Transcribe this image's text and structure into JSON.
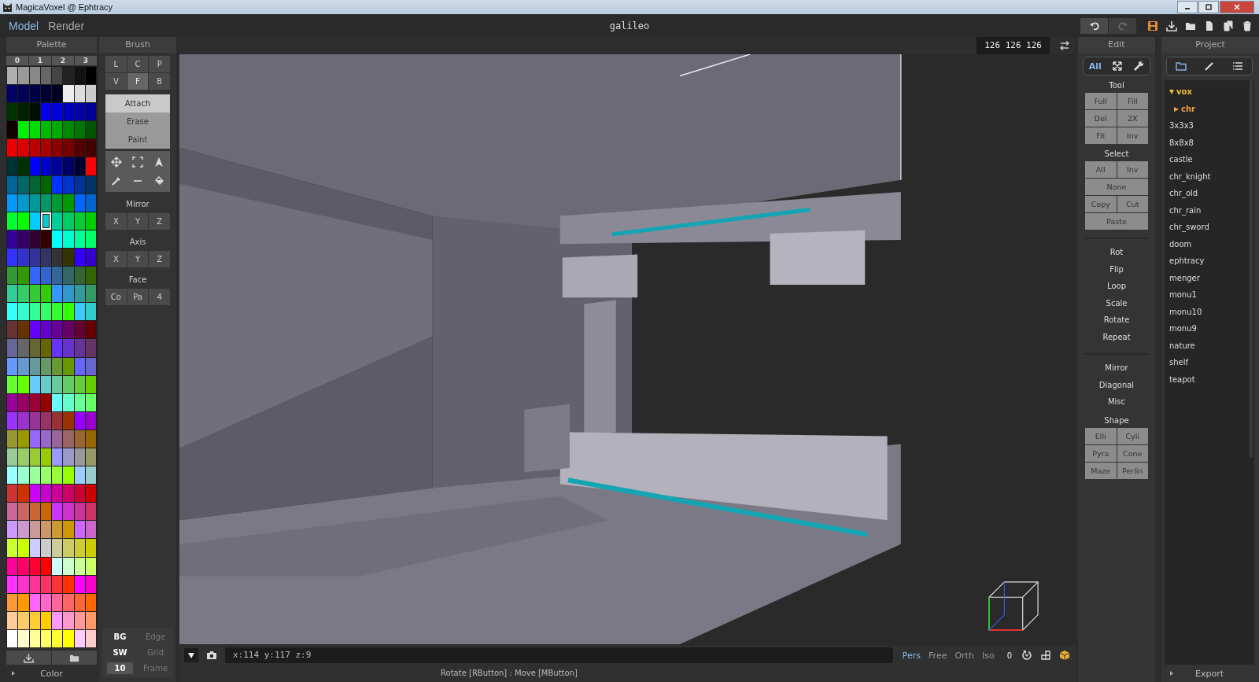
{
  "window": {
    "title": "MagicaVoxel @ Ephtracy"
  },
  "modes": [
    {
      "label": "Model",
      "selected": true
    },
    {
      "label": "Render",
      "selected": false
    }
  ],
  "document_title": "galileo",
  "palette": {
    "title": "Palette",
    "pages": [
      {
        "label": "0"
      },
      {
        "label": "1"
      },
      {
        "label": "2"
      },
      {
        "label": "3"
      }
    ],
    "swatches": [
      {
        "color": "#b0b0b0",
        "selected": false
      },
      {
        "color": "#999999",
        "selected": false
      },
      {
        "color": "#888888",
        "selected": false
      },
      {
        "color": "#666666",
        "selected": false
      },
      {
        "color": "#444444",
        "selected": false
      },
      {
        "color": "#222222",
        "selected": false
      },
      {
        "color": "#111111",
        "selected": false
      },
      {
        "color": "#000000",
        "selected": false
      },
      {
        "color": "#000066",
        "selected": false
      },
      {
        "color": "#000055",
        "selected": false
      },
      {
        "color": "#000044",
        "selected": false
      },
      {
        "color": "#000033",
        "selected": false
      },
      {
        "color": "#000022",
        "selected": false
      },
      {
        "color": "#eeeeee",
        "selected": false
      },
      {
        "color": "#dddddd",
        "selected": false
      },
      {
        "color": "#cccccc",
        "selected": false
      },
      {
        "color": "#003300",
        "selected": false
      },
      {
        "color": "#002200",
        "selected": false
      },
      {
        "color": "#001100",
        "selected": false
      },
      {
        "color": "#0000ee",
        "selected": false
      },
      {
        "color": "#0000dd",
        "selected": false
      },
      {
        "color": "#0000bb",
        "selected": false
      },
      {
        "color": "#0000aa",
        "selected": false
      },
      {
        "color": "#000099",
        "selected": false
      },
      {
        "color": "#110000",
        "selected": false
      },
      {
        "color": "#00ee00",
        "selected": false
      },
      {
        "color": "#00dd00",
        "selected": false
      },
      {
        "color": "#00bb00",
        "selected": false
      },
      {
        "color": "#00aa00",
        "selected": false
      },
      {
        "color": "#008800",
        "selected": false
      },
      {
        "color": "#007700",
        "selected": false
      },
      {
        "color": "#005500",
        "selected": false
      },
      {
        "color": "#ee0000",
        "selected": false
      },
      {
        "color": "#dd0000",
        "selected": false
      },
      {
        "color": "#bb0000",
        "selected": false
      },
      {
        "color": "#aa0000",
        "selected": false
      },
      {
        "color": "#880000",
        "selected": false
      },
      {
        "color": "#770000",
        "selected": false
      },
      {
        "color": "#550000",
        "selected": false
      },
      {
        "color": "#440000",
        "selected": false
      },
      {
        "color": "#003333",
        "selected": false
      },
      {
        "color": "#003300",
        "selected": false
      },
      {
        "color": "#0000ff",
        "selected": false
      },
      {
        "color": "#0000cc",
        "selected": false
      },
      {
        "color": "#000099",
        "selected": false
      },
      {
        "color": "#000066",
        "selected": false
      },
      {
        "color": "#000033",
        "selected": false
      },
      {
        "color": "#ff0000",
        "selected": false
      },
      {
        "color": "#006699",
        "selected": false
      },
      {
        "color": "#006666",
        "selected": false
      },
      {
        "color": "#006633",
        "selected": false
      },
      {
        "color": "#006600",
        "selected": false
      },
      {
        "color": "#0033ff",
        "selected": false
      },
      {
        "color": "#0033cc",
        "selected": false
      },
      {
        "color": "#003399",
        "selected": false
      },
      {
        "color": "#003366",
        "selected": false
      },
      {
        "color": "#0099ff",
        "selected": false
      },
      {
        "color": "#0099cc",
        "selected": false
      },
      {
        "color": "#009999",
        "selected": false
      },
      {
        "color": "#009966",
        "selected": false
      },
      {
        "color": "#009933",
        "selected": false
      },
      {
        "color": "#009900",
        "selected": false
      },
      {
        "color": "#0066ff",
        "selected": false
      },
      {
        "color": "#0066cc",
        "selected": false
      },
      {
        "color": "#00ff33",
        "selected": false
      },
      {
        "color": "#00ff00",
        "selected": false
      },
      {
        "color": "#00ccff",
        "selected": false
      },
      {
        "color": "#00cccc",
        "selected": true
      },
      {
        "color": "#00cc99",
        "selected": false
      },
      {
        "color": "#00cc66",
        "selected": false
      },
      {
        "color": "#00cc33",
        "selected": false
      },
      {
        "color": "#00cc00",
        "selected": false
      },
      {
        "color": "#330099",
        "selected": false
      },
      {
        "color": "#330066",
        "selected": false
      },
      {
        "color": "#330033",
        "selected": false
      },
      {
        "color": "#330000",
        "selected": false
      },
      {
        "color": "#00ffff",
        "selected": false
      },
      {
        "color": "#00ffcc",
        "selected": false
      },
      {
        "color": "#00ff99",
        "selected": false
      },
      {
        "color": "#00ff66",
        "selected": false
      },
      {
        "color": "#3333ff",
        "selected": false
      },
      {
        "color": "#3333cc",
        "selected": false
      },
      {
        "color": "#333399",
        "selected": false
      },
      {
        "color": "#333366",
        "selected": false
      },
      {
        "color": "#333333",
        "selected": false
      },
      {
        "color": "#333300",
        "selected": false
      },
      {
        "color": "#3300ff",
        "selected": false
      },
      {
        "color": "#3300cc",
        "selected": false
      },
      {
        "color": "#339933",
        "selected": false
      },
      {
        "color": "#339900",
        "selected": false
      },
      {
        "color": "#3366ff",
        "selected": false
      },
      {
        "color": "#3366cc",
        "selected": false
      },
      {
        "color": "#336699",
        "selected": false
      },
      {
        "color": "#336666",
        "selected": false
      },
      {
        "color": "#336633",
        "selected": false
      },
      {
        "color": "#336600",
        "selected": false
      },
      {
        "color": "#33cc99",
        "selected": false
      },
      {
        "color": "#33cc66",
        "selected": false
      },
      {
        "color": "#33cc33",
        "selected": false
      },
      {
        "color": "#33cc00",
        "selected": false
      },
      {
        "color": "#3399ff",
        "selected": false
      },
      {
        "color": "#3399cc",
        "selected": false
      },
      {
        "color": "#339999",
        "selected": false
      },
      {
        "color": "#339966",
        "selected": false
      },
      {
        "color": "#33ffff",
        "selected": false
      },
      {
        "color": "#33ffcc",
        "selected": false
      },
      {
        "color": "#33ff99",
        "selected": false
      },
      {
        "color": "#33ff66",
        "selected": false
      },
      {
        "color": "#33ff33",
        "selected": false
      },
      {
        "color": "#33ff00",
        "selected": false
      },
      {
        "color": "#33ccff",
        "selected": false
      },
      {
        "color": "#33cccc",
        "selected": false
      },
      {
        "color": "#663333",
        "selected": false
      },
      {
        "color": "#663300",
        "selected": false
      },
      {
        "color": "#6600ff",
        "selected": false
      },
      {
        "color": "#6600cc",
        "selected": false
      },
      {
        "color": "#660099",
        "selected": false
      },
      {
        "color": "#660066",
        "selected": false
      },
      {
        "color": "#660033",
        "selected": false
      },
      {
        "color": "#660000",
        "selected": false
      },
      {
        "color": "#666699",
        "selected": false
      },
      {
        "color": "#666666",
        "selected": false
      },
      {
        "color": "#666633",
        "selected": false
      },
      {
        "color": "#666600",
        "selected": false
      },
      {
        "color": "#6633ff",
        "selected": false
      },
      {
        "color": "#6633cc",
        "selected": false
      },
      {
        "color": "#663399",
        "selected": false
      },
      {
        "color": "#663366",
        "selected": false
      },
      {
        "color": "#6699ff",
        "selected": false
      },
      {
        "color": "#6699cc",
        "selected": false
      },
      {
        "color": "#669999",
        "selected": false
      },
      {
        "color": "#669966",
        "selected": false
      },
      {
        "color": "#669933",
        "selected": false
      },
      {
        "color": "#669900",
        "selected": false
      },
      {
        "color": "#6666ff",
        "selected": false
      },
      {
        "color": "#6666cc",
        "selected": false
      },
      {
        "color": "#66ff33",
        "selected": false
      },
      {
        "color": "#66ff00",
        "selected": false
      },
      {
        "color": "#66ccff",
        "selected": false
      },
      {
        "color": "#66cccc",
        "selected": false
      },
      {
        "color": "#66cc99",
        "selected": false
      },
      {
        "color": "#66cc66",
        "selected": false
      },
      {
        "color": "#66cc33",
        "selected": false
      },
      {
        "color": "#66cc00",
        "selected": false
      },
      {
        "color": "#990099",
        "selected": false
      },
      {
        "color": "#990066",
        "selected": false
      },
      {
        "color": "#990033",
        "selected": false
      },
      {
        "color": "#990000",
        "selected": false
      },
      {
        "color": "#66ffff",
        "selected": false
      },
      {
        "color": "#66ffcc",
        "selected": false
      },
      {
        "color": "#66ff99",
        "selected": false
      },
      {
        "color": "#66ff66",
        "selected": false
      },
      {
        "color": "#9933ff",
        "selected": false
      },
      {
        "color": "#9933cc",
        "selected": false
      },
      {
        "color": "#993399",
        "selected": false
      },
      {
        "color": "#993366",
        "selected": false
      },
      {
        "color": "#993333",
        "selected": false
      },
      {
        "color": "#993300",
        "selected": false
      },
      {
        "color": "#9900ff",
        "selected": false
      },
      {
        "color": "#9900cc",
        "selected": false
      },
      {
        "color": "#999933",
        "selected": false
      },
      {
        "color": "#999900",
        "selected": false
      },
      {
        "color": "#9966ff",
        "selected": false
      },
      {
        "color": "#9966cc",
        "selected": false
      },
      {
        "color": "#996699",
        "selected": false
      },
      {
        "color": "#996666",
        "selected": false
      },
      {
        "color": "#996633",
        "selected": false
      },
      {
        "color": "#996600",
        "selected": false
      },
      {
        "color": "#99cc99",
        "selected": false
      },
      {
        "color": "#99cc66",
        "selected": false
      },
      {
        "color": "#99cc33",
        "selected": false
      },
      {
        "color": "#99cc00",
        "selected": false
      },
      {
        "color": "#9999ff",
        "selected": false
      },
      {
        "color": "#9999cc",
        "selected": false
      },
      {
        "color": "#999999",
        "selected": false
      },
      {
        "color": "#999966",
        "selected": false
      },
      {
        "color": "#99ffff",
        "selected": false
      },
      {
        "color": "#99ffcc",
        "selected": false
      },
      {
        "color": "#99ff99",
        "selected": false
      },
      {
        "color": "#99ff66",
        "selected": false
      },
      {
        "color": "#99ff33",
        "selected": false
      },
      {
        "color": "#99ff00",
        "selected": false
      },
      {
        "color": "#99ccff",
        "selected": false
      },
      {
        "color": "#99cccc",
        "selected": false
      },
      {
        "color": "#cc3333",
        "selected": false
      },
      {
        "color": "#cc3300",
        "selected": false
      },
      {
        "color": "#cc00ff",
        "selected": false
      },
      {
        "color": "#cc00cc",
        "selected": false
      },
      {
        "color": "#cc0099",
        "selected": false
      },
      {
        "color": "#cc0066",
        "selected": false
      },
      {
        "color": "#cc0033",
        "selected": false
      },
      {
        "color": "#cc0000",
        "selected": false
      },
      {
        "color": "#cc6699",
        "selected": false
      },
      {
        "color": "#cc6666",
        "selected": false
      },
      {
        "color": "#cc6633",
        "selected": false
      },
      {
        "color": "#cc6600",
        "selected": false
      },
      {
        "color": "#cc33ff",
        "selected": false
      },
      {
        "color": "#cc33cc",
        "selected": false
      },
      {
        "color": "#cc3399",
        "selected": false
      },
      {
        "color": "#cc3366",
        "selected": false
      },
      {
        "color": "#cc99ff",
        "selected": false
      },
      {
        "color": "#cc99cc",
        "selected": false
      },
      {
        "color": "#cc9999",
        "selected": false
      },
      {
        "color": "#cc9966",
        "selected": false
      },
      {
        "color": "#cc9933",
        "selected": false
      },
      {
        "color": "#cc9900",
        "selected": false
      },
      {
        "color": "#cc66ff",
        "selected": false
      },
      {
        "color": "#cc66cc",
        "selected": false
      },
      {
        "color": "#ccff33",
        "selected": false
      },
      {
        "color": "#ccff00",
        "selected": false
      },
      {
        "color": "#ccccff",
        "selected": false
      },
      {
        "color": "#cccccc",
        "selected": false
      },
      {
        "color": "#cccc99",
        "selected": false
      },
      {
        "color": "#cccc66",
        "selected": false
      },
      {
        "color": "#cccc33",
        "selected": false
      },
      {
        "color": "#cccc00",
        "selected": false
      },
      {
        "color": "#ff0099",
        "selected": false
      },
      {
        "color": "#ff0066",
        "selected": false
      },
      {
        "color": "#ff0033",
        "selected": false
      },
      {
        "color": "#ff0000",
        "selected": false
      },
      {
        "color": "#ccffff",
        "selected": false
      },
      {
        "color": "#ccffcc",
        "selected": false
      },
      {
        "color": "#ccff99",
        "selected": false
      },
      {
        "color": "#ccff66",
        "selected": false
      },
      {
        "color": "#ff33ff",
        "selected": false
      },
      {
        "color": "#ff33cc",
        "selected": false
      },
      {
        "color": "#ff3399",
        "selected": false
      },
      {
        "color": "#ff3366",
        "selected": false
      },
      {
        "color": "#ff3333",
        "selected": false
      },
      {
        "color": "#ff3300",
        "selected": false
      },
      {
        "color": "#ff00ff",
        "selected": false
      },
      {
        "color": "#ff00cc",
        "selected": false
      },
      {
        "color": "#ff9933",
        "selected": false
      },
      {
        "color": "#ff9900",
        "selected": false
      },
      {
        "color": "#ff66ff",
        "selected": false
      },
      {
        "color": "#ff66cc",
        "selected": false
      },
      {
        "color": "#ff6699",
        "selected": false
      },
      {
        "color": "#ff6666",
        "selected": false
      },
      {
        "color": "#ff6633",
        "selected": false
      },
      {
        "color": "#ff6600",
        "selected": false
      },
      {
        "color": "#ffcc99",
        "selected": false
      },
      {
        "color": "#ffcc66",
        "selected": false
      },
      {
        "color": "#ffcc33",
        "selected": false
      },
      {
        "color": "#ffcc00",
        "selected": false
      },
      {
        "color": "#ff99ff",
        "selected": false
      },
      {
        "color": "#ff99cc",
        "selected": false
      },
      {
        "color": "#ff9999",
        "selected": false
      },
      {
        "color": "#ff9966",
        "selected": false
      },
      {
        "color": "#ffffff",
        "selected": false
      },
      {
        "color": "#ffffcc",
        "selected": false
      },
      {
        "color": "#ffff99",
        "selected": false
      },
      {
        "color": "#ffff66",
        "selected": false
      },
      {
        "color": "#ffff33",
        "selected": false
      },
      {
        "color": "#ffff00",
        "selected": false
      },
      {
        "color": "#ffccff",
        "selected": false
      },
      {
        "color": "#ffcccc",
        "selected": false
      }
    ],
    "footer_label": "Color"
  },
  "brush": {
    "title": "Brush",
    "shapes": [
      {
        "label": "L",
        "selected": false
      },
      {
        "label": "C",
        "selected": false
      },
      {
        "label": "P",
        "selected": false
      },
      {
        "label": "V",
        "selected": false
      },
      {
        "label": "F",
        "selected": true
      },
      {
        "label": "B",
        "selected": false
      }
    ],
    "actions": [
      {
        "label": "Attach",
        "selected": true
      },
      {
        "label": "Erase",
        "selected": false
      },
      {
        "label": "Paint",
        "selected": false
      }
    ],
    "groups": [
      {
        "title": "Mirror",
        "buttons": [
          "X",
          "Y",
          "Z"
        ]
      },
      {
        "title": "Axis",
        "buttons": [
          "X",
          "Y",
          "Z"
        ]
      },
      {
        "title": "Face",
        "buttons": [
          "Co",
          "Pa",
          "4"
        ]
      }
    ],
    "display": [
      {
        "kind": "toggle",
        "label": "BG",
        "on": true
      },
      {
        "kind": "toggle",
        "label": "Edge",
        "on": false
      },
      {
        "kind": "toggle",
        "label": "SW",
        "on": true
      },
      {
        "kind": "toggle",
        "label": "Grid",
        "on": false
      },
      {
        "kind": "field",
        "value": "10"
      },
      {
        "kind": "toggle",
        "label": "Frame",
        "on": false
      }
    ]
  },
  "viewport": {
    "dimensions": "126 126 126",
    "coordinates": "x:114 y:117 z:9",
    "views": [
      {
        "label": "Pers",
        "selected": true
      },
      {
        "label": "Free",
        "selected": false
      },
      {
        "label": "Orth",
        "selected": false
      },
      {
        "label": "Iso",
        "selected": false
      }
    ],
    "counter": "0"
  },
  "status_bar": "Rotate [RButton] : Move [MButton]",
  "edit": {
    "title": "Edit",
    "tab_label": "All",
    "sections": [
      {
        "kind": "buttons",
        "title": "Tool",
        "rows": [
          [
            "Full",
            "Fill"
          ],
          [
            "Del",
            "2X"
          ],
          [
            "Fit",
            "Inv"
          ]
        ]
      },
      {
        "kind": "buttons",
        "title": "Select",
        "rows": [
          [
            "All",
            "Inv"
          ],
          [
            "None"
          ],
          [
            "Copy",
            "Cut"
          ],
          [
            "Paste"
          ]
        ]
      },
      {
        "kind": "commands",
        "items": [
          "Rot",
          "Flip",
          "Loop",
          "Scale",
          "Rotate",
          "Repeat"
        ]
      },
      {
        "kind": "commands",
        "items": [
          "Mirror",
          "Diagonal",
          "Misc"
        ]
      },
      {
        "kind": "buttons",
        "title": "Shape",
        "rows": [
          [
            "Elli",
            "Cyli"
          ],
          [
            "Pyra",
            "Cone"
          ],
          [
            "Maze",
            "Perlin"
          ]
        ]
      }
    ]
  },
  "project": {
    "title": "Project",
    "tree": [
      {
        "label": "vox",
        "kind": "folder",
        "expanded": true,
        "children": [
          {
            "label": "chr",
            "kind": "folder",
            "expanded": false
          },
          {
            "label": "3x3x3",
            "kind": "file"
          },
          {
            "label": "8x8x8",
            "kind": "file"
          },
          {
            "label": "castle",
            "kind": "file"
          },
          {
            "label": "chr_knight",
            "kind": "file"
          },
          {
            "label": "chr_old",
            "kind": "file"
          },
          {
            "label": "chr_rain",
            "kind": "file"
          },
          {
            "label": "chr_sword",
            "kind": "file"
          },
          {
            "label": "doom",
            "kind": "file"
          },
          {
            "label": "ephtracy",
            "kind": "file"
          },
          {
            "label": "menger",
            "kind": "file"
          },
          {
            "label": "monu1",
            "kind": "file"
          },
          {
            "label": "monu10",
            "kind": "file"
          },
          {
            "label": "monu9",
            "kind": "file"
          },
          {
            "label": "nature",
            "kind": "file"
          },
          {
            "label": "shelf",
            "kind": "file"
          },
          {
            "label": "teapot",
            "kind": "file"
          }
        ]
      }
    ],
    "footer_label": "Export"
  }
}
